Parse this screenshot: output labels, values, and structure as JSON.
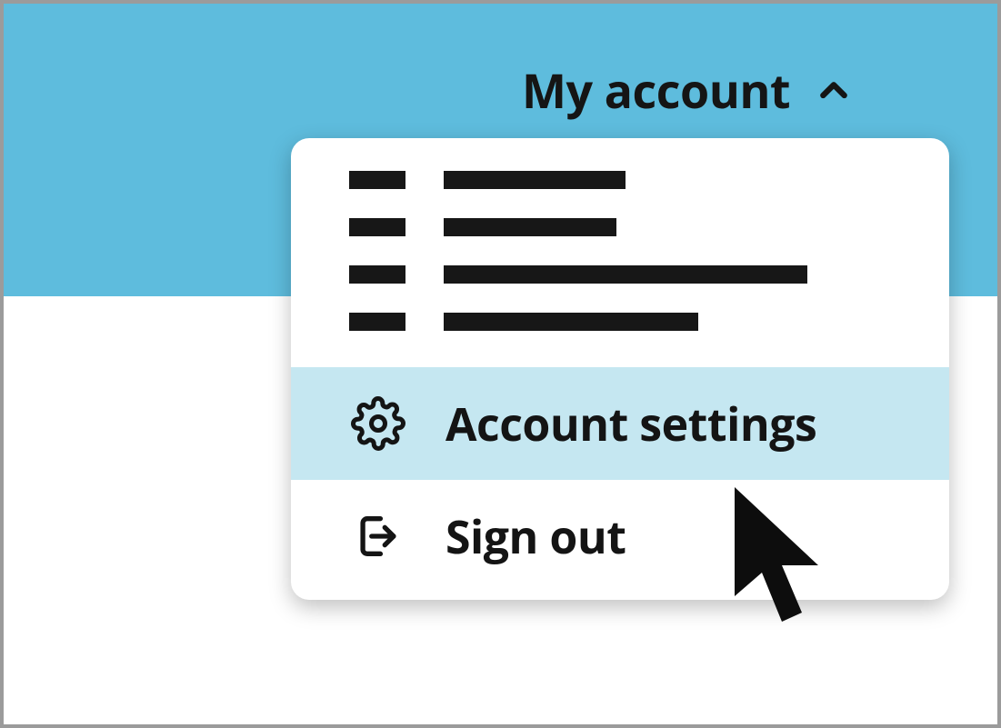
{
  "header": {
    "trigger_label": "My account"
  },
  "menu": {
    "account_settings_label": "Account settings",
    "sign_out_label": "Sign out"
  },
  "colors": {
    "banner": "#5ebcdd",
    "hover": "#c5e7f1"
  }
}
